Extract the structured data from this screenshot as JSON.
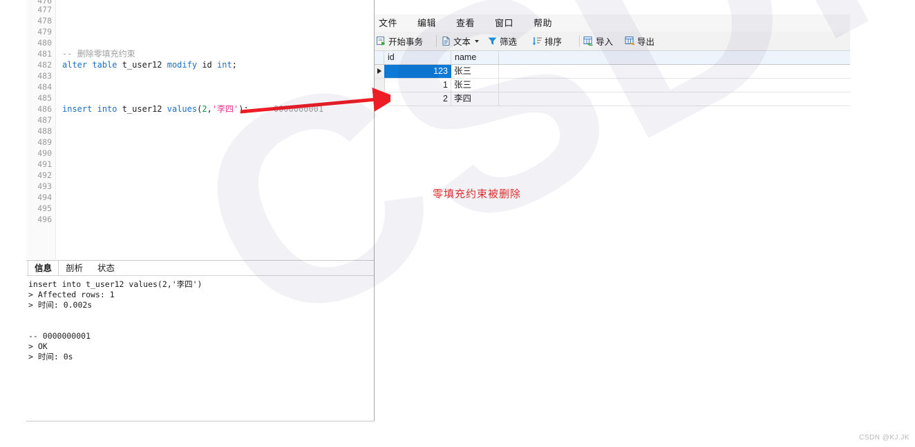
{
  "editor": {
    "first_partial_line": "476",
    "line_numbers": [
      "477",
      "478",
      "479",
      "480",
      "481",
      "482",
      "483",
      "484",
      "485",
      "486",
      "487",
      "488",
      "489",
      "490",
      "491",
      "492",
      "493",
      "494",
      "495",
      "496"
    ],
    "lines": [
      {
        "n": "477",
        "tokens": []
      },
      {
        "n": "478",
        "tokens": []
      },
      {
        "n": "479",
        "tokens": []
      },
      {
        "n": "480",
        "tokens": []
      },
      {
        "n": "481",
        "tokens": [
          {
            "t": "-- 删除零填充约束",
            "c": "cmt"
          }
        ]
      },
      {
        "n": "482",
        "tokens": [
          {
            "t": "alter",
            "c": "kw"
          },
          {
            "t": " ",
            "c": "plain"
          },
          {
            "t": "table",
            "c": "kw"
          },
          {
            "t": " t_user12 ",
            "c": "plain"
          },
          {
            "t": "modify",
            "c": "kw"
          },
          {
            "t": " id ",
            "c": "plain"
          },
          {
            "t": "int",
            "c": "kw"
          },
          {
            "t": ";",
            "c": "plain"
          }
        ]
      },
      {
        "n": "483",
        "tokens": []
      },
      {
        "n": "484",
        "tokens": []
      },
      {
        "n": "485",
        "tokens": []
      },
      {
        "n": "486",
        "tokens": [
          {
            "t": "insert",
            "c": "kw"
          },
          {
            "t": " ",
            "c": "plain"
          },
          {
            "t": "into",
            "c": "kw"
          },
          {
            "t": " t_user12 ",
            "c": "plain"
          },
          {
            "t": "values",
            "c": "kw"
          },
          {
            "t": "(",
            "c": "plain"
          },
          {
            "t": "2",
            "c": "num"
          },
          {
            "t": ",",
            "c": "plain"
          },
          {
            "t": "'李四'",
            "c": "str"
          },
          {
            "t": ");  ",
            "c": "plain"
          },
          {
            "t": "-- 0000000001",
            "c": "cmt"
          }
        ]
      },
      {
        "n": "487",
        "tokens": []
      },
      {
        "n": "488",
        "tokens": []
      },
      {
        "n": "489",
        "tokens": []
      },
      {
        "n": "490",
        "tokens": []
      },
      {
        "n": "491",
        "tokens": []
      },
      {
        "n": "492",
        "tokens": []
      },
      {
        "n": "493",
        "tokens": []
      },
      {
        "n": "494",
        "tokens": []
      },
      {
        "n": "495",
        "tokens": []
      },
      {
        "n": "496",
        "tokens": []
      }
    ]
  },
  "output": {
    "tabs": [
      {
        "label": "信息",
        "active": true
      },
      {
        "label": "剖析",
        "active": false
      },
      {
        "label": "状态",
        "active": false
      }
    ],
    "lines": [
      "insert into t_user12 values(2,'李四')",
      "> Affected rows: 1",
      "> 时间: 0.002s",
      "",
      "",
      "-- 0000000001",
      "> OK",
      "> 时间: 0s"
    ]
  },
  "grid_window": {
    "menu": [
      {
        "label": "文件"
      },
      {
        "label": "编辑"
      },
      {
        "label": "查看"
      },
      {
        "label": "窗口"
      },
      {
        "label": "帮助"
      }
    ],
    "toolbar": [
      {
        "label": "开始事务",
        "icon": "transaction-icon",
        "dropdown": false
      },
      {
        "label": "文本",
        "icon": "text-icon",
        "dropdown": true
      },
      {
        "label": "筛选",
        "icon": "filter-icon",
        "dropdown": false
      },
      {
        "label": "排序",
        "icon": "sort-icon",
        "dropdown": false
      },
      {
        "label": "导入",
        "icon": "import-icon",
        "dropdown": false
      },
      {
        "label": "导出",
        "icon": "export-icon",
        "dropdown": false
      }
    ],
    "grid": {
      "columns": [
        "id",
        "name"
      ],
      "rows": [
        {
          "id": "123",
          "name": "张三",
          "selected": true,
          "current": true
        },
        {
          "id": "1",
          "name": "张三",
          "selected": false,
          "current": false
        },
        {
          "id": "2",
          "name": "李四",
          "selected": false,
          "current": false
        }
      ]
    }
  },
  "annotations": {
    "red_note": "零填充约束被删除",
    "arrow_color": "#ee1c24"
  },
  "watermark": {
    "big": "CSDN@KJ.JK",
    "corner": "CSDN @KJ.JK"
  },
  "colors": {
    "accent_selection": "#0c7ad6",
    "annotation_red": "#e8302c",
    "keyword_blue": "#1a6fc4",
    "string_pink": "#e8348d",
    "number_green": "#0a9a3d",
    "comment_grey": "#a0a0a0"
  }
}
